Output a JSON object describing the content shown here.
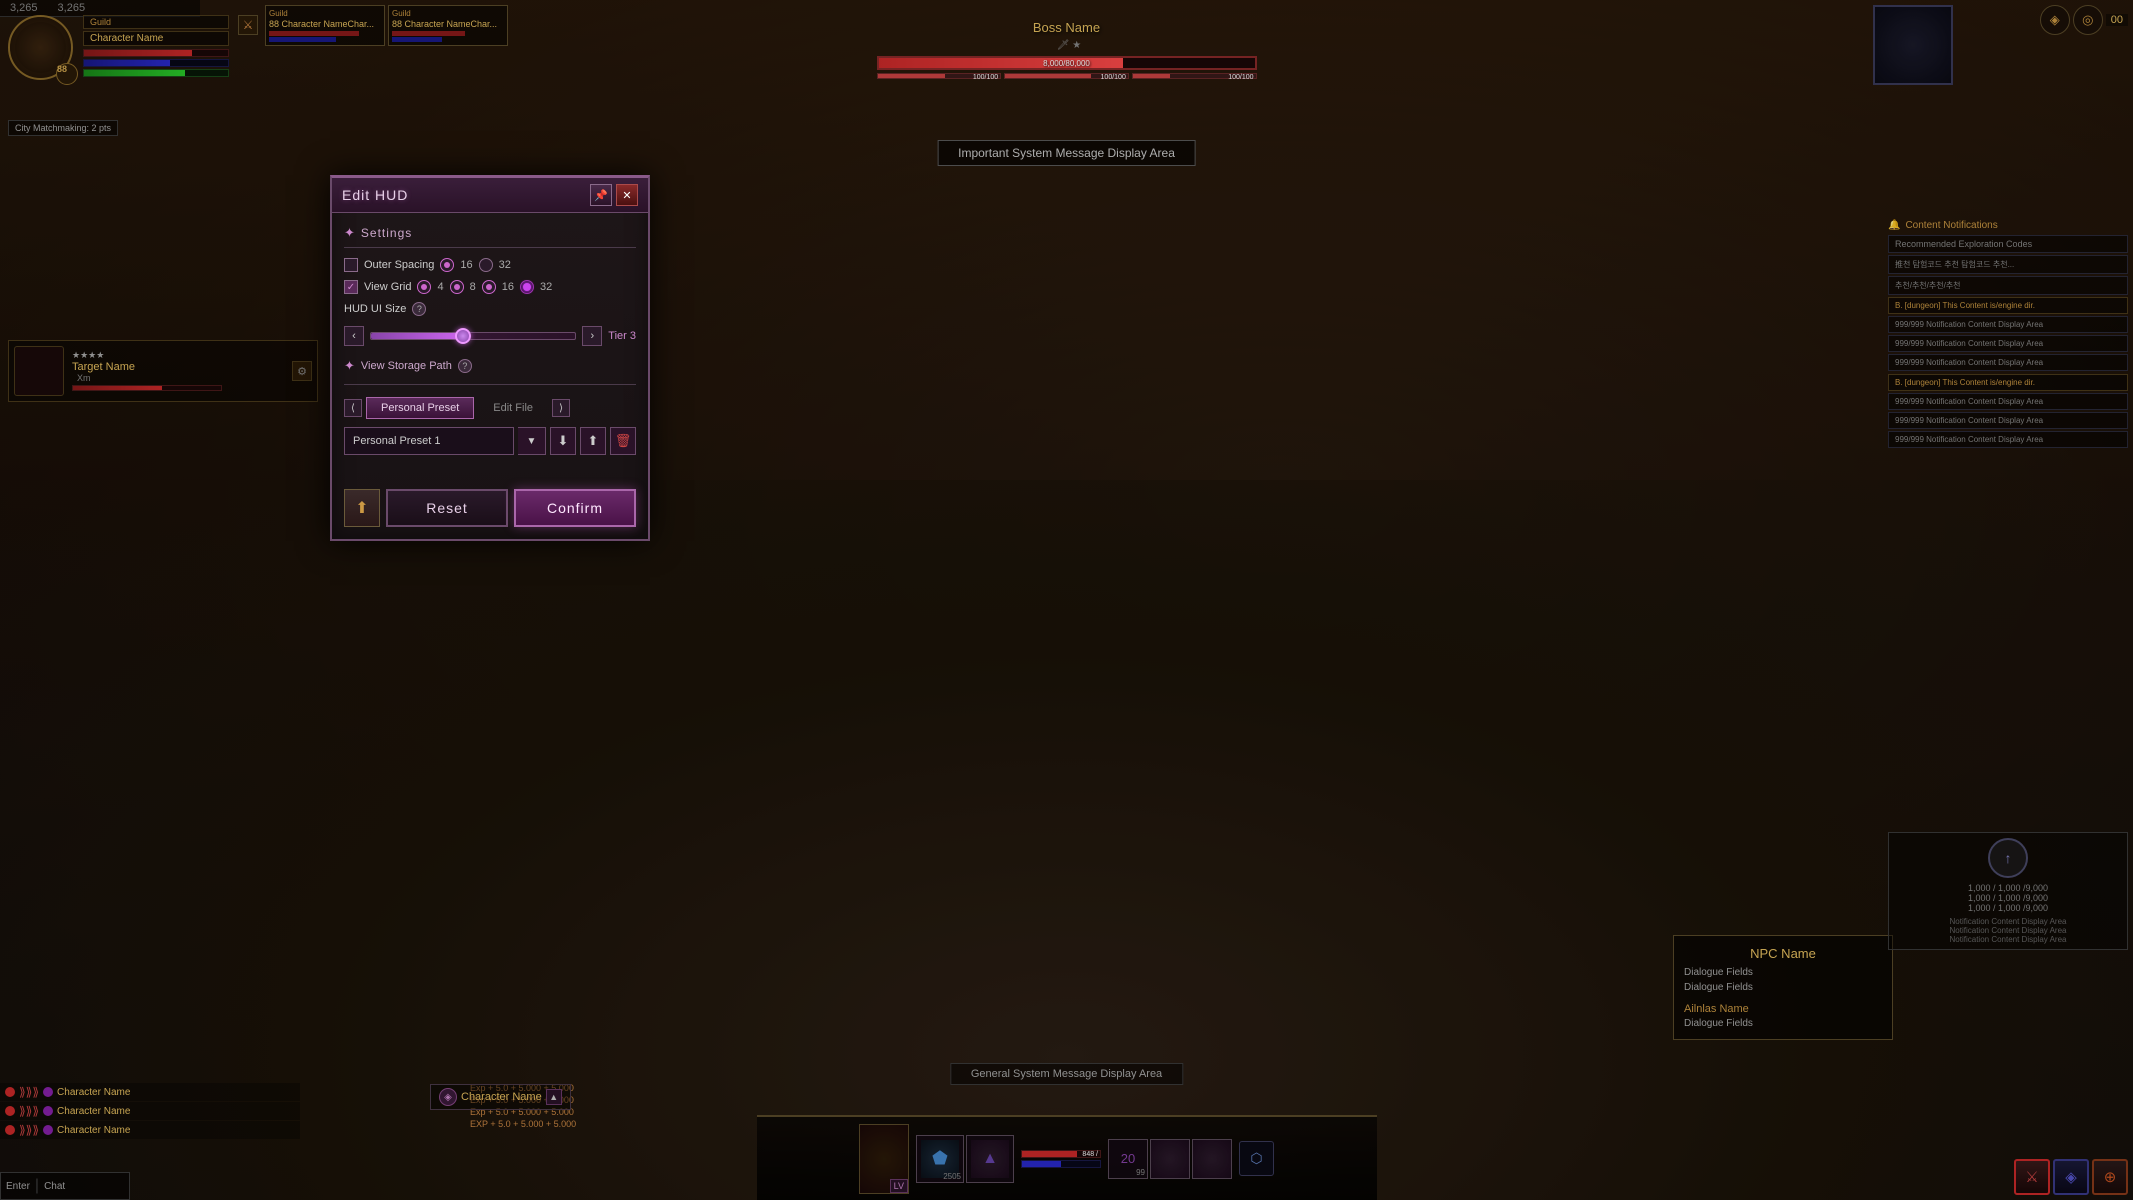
{
  "game": {
    "coords": {
      "x": "3,265",
      "y": "3,265"
    },
    "currency": "00"
  },
  "player": {
    "level": "88",
    "name": "Character Name",
    "guild": "Guild",
    "hp_pct": 75,
    "mp_pct": 60,
    "sp_pct": 70
  },
  "party": [
    {
      "level": "88",
      "name": "Character NameCharacter Name",
      "hp": 80
    },
    {
      "level": "88",
      "name": "Character NameCharacter",
      "hp": 65
    }
  ],
  "boss": {
    "name": "Boss Name",
    "hp_pct": 65,
    "stats": "8,000/80,000"
  },
  "system_msg": "Important System Message Display Area",
  "general_system_msg": "General System Message Display Area",
  "target": {
    "name": "Target Name",
    "distance": "Xm"
  },
  "npc": {
    "name": "NPC Name",
    "dialogue": "Dialogue Fields",
    "alt_name": "Ailnlas Name",
    "dialogue2": "Dialogue Fields"
  },
  "edit_hud": {
    "title": "Edit HUD",
    "title_btn_pin": "📌",
    "title_btn_close": "✕",
    "settings_label": "Settings",
    "outer_spacing_label": "Outer Spacing",
    "outer_spacing_16": "16",
    "outer_spacing_32": "32",
    "view_grid_label": "View Grid",
    "grid_4": "4",
    "grid_8": "8",
    "grid_16": "16",
    "grid_32": "32",
    "hud_ui_size_label": "HUD UI Size",
    "hud_ui_size_question": "?",
    "tier_label": "Tier 3",
    "view_storage_label": "View Storage Path",
    "view_storage_question": "?",
    "tab_personal_preset": "Personal Preset",
    "tab_edit_file": "Edit File",
    "preset_name": "Personal Preset 1",
    "reset_label": "Reset",
    "confirm_label": "Confirm"
  },
  "notifications": {
    "title": "Content Notifications",
    "items": [
      "Recommended Exploration Codes",
      "推천 탐험코드 추천 탐험코드 추천 탐험코드",
      "추천/추천/추천/추천",
      "B. [dungeon] This Content is/engine dir.",
      "999/999 Notification Content Display Area",
      "999/999 Notification Content Display Area",
      "999/999 Notification Content Display Area",
      "B. [dungeon] This Content is/engine dir.",
      "999/999 Notification Content Display Area",
      "999/999 Notification Content Display Area",
      "999/999 Notification Content Display Area"
    ]
  },
  "combat_log": {
    "lines": [
      "Exp + 5.0 + 5.000 + 5.000",
      "Exp + 5.0 + 5.000 + 5.000",
      "Exp + 5.0 + 5.000 + 5.000",
      "EXP + 5.0 + 5.000 + 5.000"
    ]
  },
  "party_combat": [
    {
      "name": "Character Name"
    },
    {
      "name": "Character Name"
    },
    {
      "name": "Character Name"
    }
  ],
  "chat": {
    "tab1": "Enter",
    "tab2": "Chat"
  },
  "inventory": {
    "slots": [
      "skill1",
      "skill2",
      "potion",
      "empty",
      "empty",
      "empty"
    ]
  },
  "right_panel_stats": {
    "hp": "1,000 / 1,000 /9,000",
    "hp2": "1,000 / 1,000 /9,000",
    "hp3": "1,000 / 1,000 /9,000"
  },
  "matchmaking": {
    "label": "City Matchmaking: 2 pts"
  }
}
